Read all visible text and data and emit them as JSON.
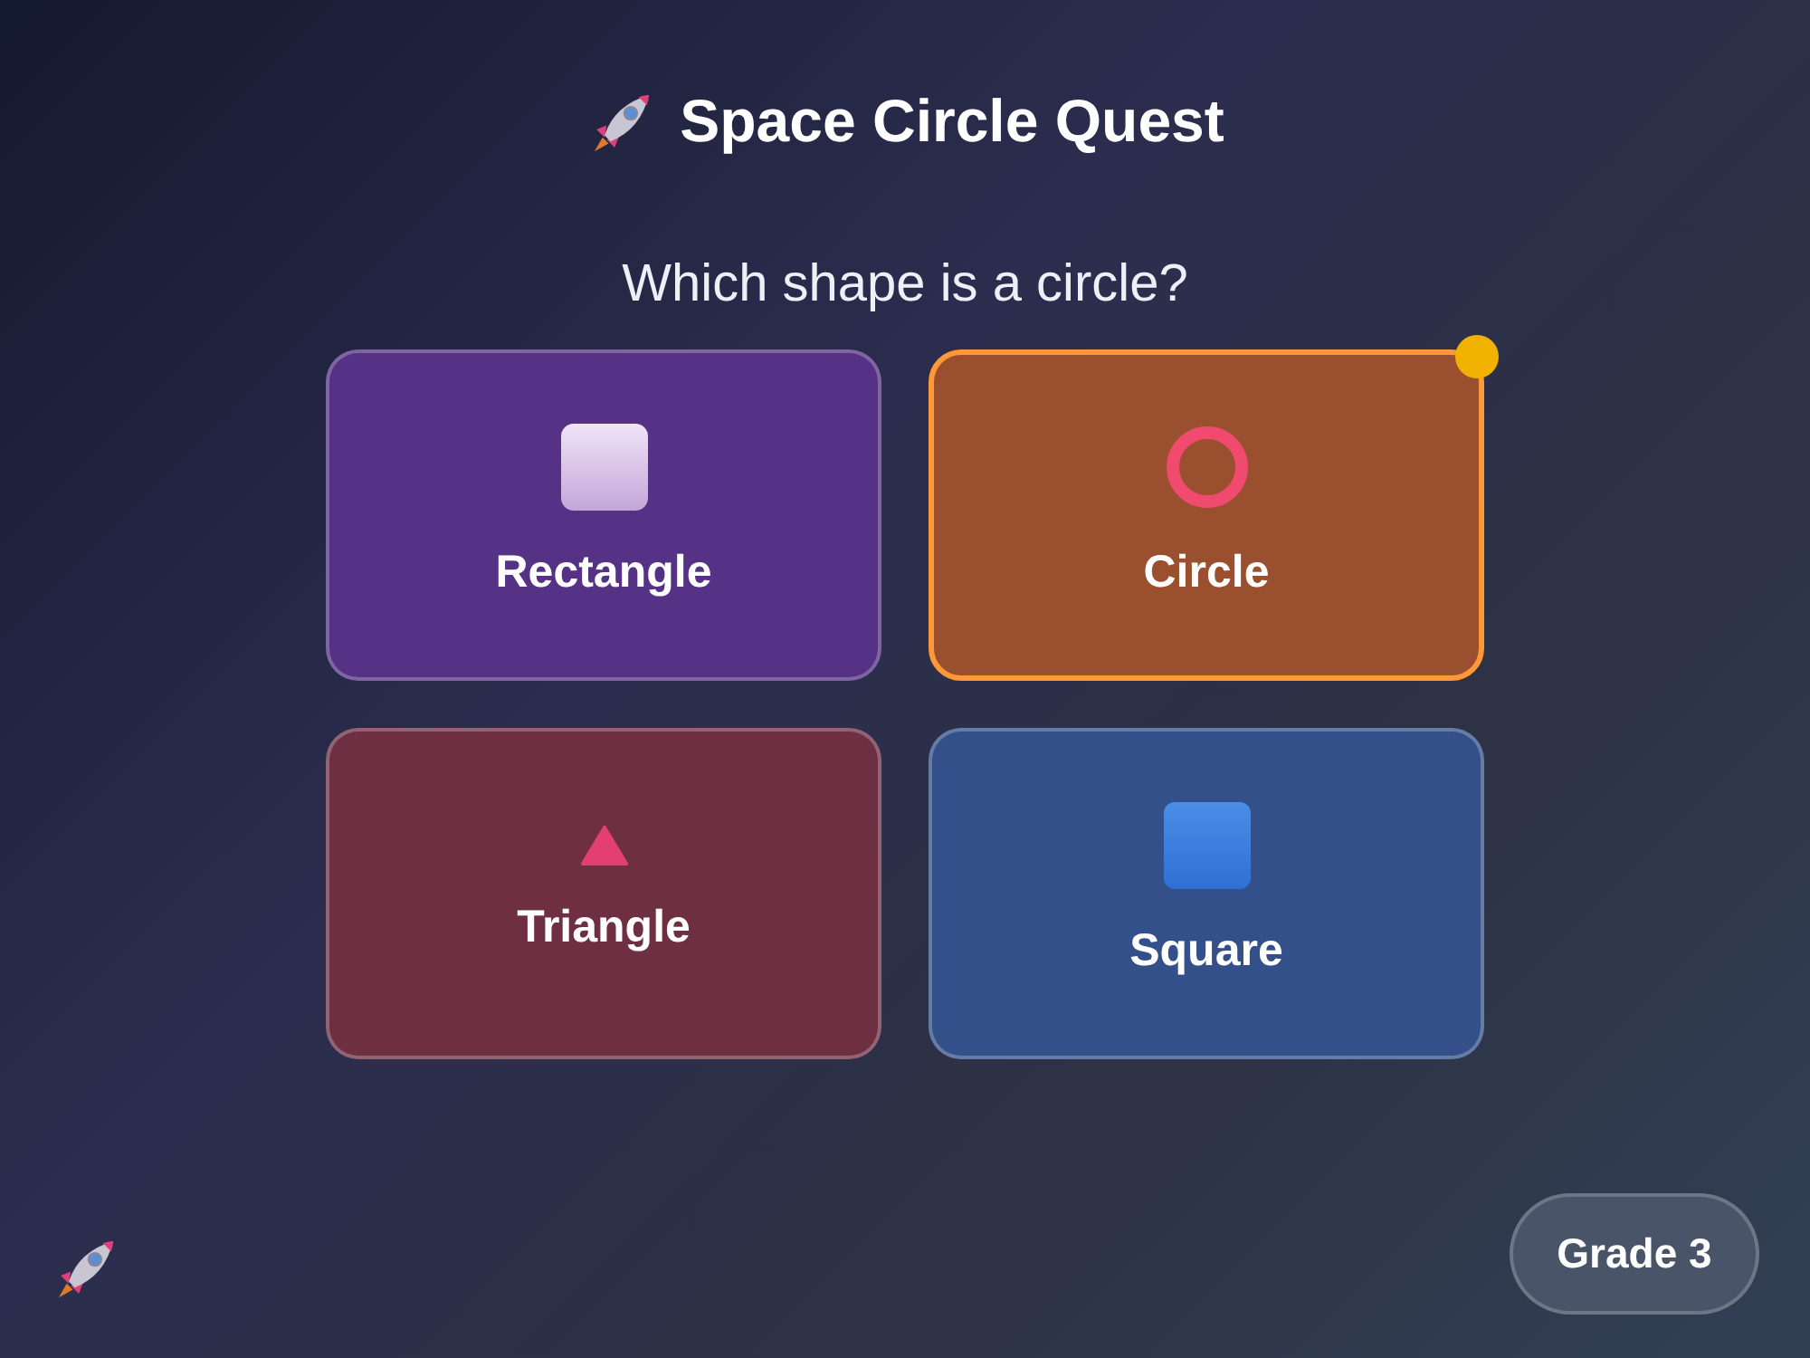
{
  "title": "Space Circle Quest",
  "question": "Which shape is a circle?",
  "options": [
    {
      "label": "Rectangle",
      "kind": "square",
      "color": "#553285",
      "selected": false
    },
    {
      "label": "Circle",
      "kind": "ring",
      "color": "#9a4f2e",
      "selected": true
    },
    {
      "label": "Triangle",
      "kind": "triangle",
      "color": "#6e2f43",
      "selected": false
    },
    {
      "label": "Square",
      "kind": "box",
      "color": "#33508a",
      "selected": false
    }
  ],
  "grade_button": "Grade 3"
}
